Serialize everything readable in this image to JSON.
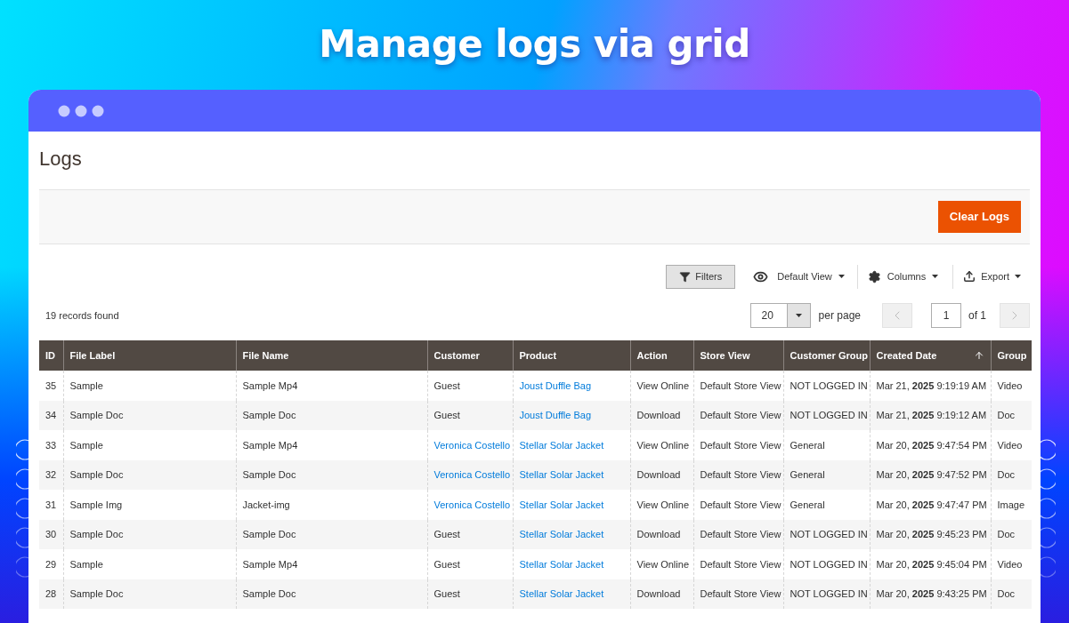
{
  "banner": {
    "title": "Manage logs via grid"
  },
  "page": {
    "title": "Logs",
    "action_button": "Clear Logs"
  },
  "toolbar": {
    "filters": {
      "label": "Filters",
      "selected": true
    },
    "view": "Default View",
    "columns": "Columns",
    "export": "Export"
  },
  "records": "19 records found",
  "pagination": {
    "per_page_value": "20",
    "per_page_label": "per page",
    "page": "1",
    "of": "of 1"
  },
  "table": {
    "columns": [
      {
        "label": "ID"
      },
      {
        "label": "File Label"
      },
      {
        "label": "File Name"
      },
      {
        "label": "Customer"
      },
      {
        "label": "Product"
      },
      {
        "label": "Action"
      },
      {
        "label": "Store View"
      },
      {
        "label": "Customer Group"
      },
      {
        "label": "Created Date",
        "sorted": true
      },
      {
        "label": "Group"
      }
    ],
    "rows": [
      {
        "cells": [
          {
            "text": "35"
          },
          {
            "text": "Sample"
          },
          {
            "text": "Sample Mp4"
          },
          {
            "text": "Guest"
          },
          {
            "text": "Joust Duffle Bag",
            "kind": "link"
          },
          {
            "text": "View Online"
          },
          {
            "text": "Default Store View"
          },
          {
            "text": "NOT LOGGED IN"
          },
          {
            "text": "Mar 21, **2025** 9:19:19 AM"
          },
          {
            "text": "Video"
          }
        ]
      },
      {
        "cells": [
          {
            "text": "34"
          },
          {
            "text": "Sample Doc"
          },
          {
            "text": "Sample Doc"
          },
          {
            "text": "Guest"
          },
          {
            "text": "Joust Duffle Bag",
            "kind": "link"
          },
          {
            "text": "Download"
          },
          {
            "text": "Default Store View"
          },
          {
            "text": "NOT LOGGED IN"
          },
          {
            "text": "Mar 21, **2025** 9:19:12 AM"
          },
          {
            "text": "Doc"
          }
        ]
      },
      {
        "cells": [
          {
            "text": "33"
          },
          {
            "text": "Sample"
          },
          {
            "text": "Sample Mp4"
          },
          {
            "text": "Veronica Costello",
            "kind": "link"
          },
          {
            "text": "Stellar Solar Jacket",
            "kind": "link"
          },
          {
            "text": "View Online"
          },
          {
            "text": "Default Store View"
          },
          {
            "text": "General"
          },
          {
            "text": "Mar 20, **2025** 9:47:54 PM"
          },
          {
            "text": "Video"
          }
        ]
      },
      {
        "cells": [
          {
            "text": "32"
          },
          {
            "text": "Sample Doc"
          },
          {
            "text": "Sample Doc"
          },
          {
            "text": "Veronica Costello",
            "kind": "link"
          },
          {
            "text": "Stellar Solar Jacket",
            "kind": "link"
          },
          {
            "text": "Download"
          },
          {
            "text": "Default Store View"
          },
          {
            "text": "General"
          },
          {
            "text": "Mar 20, **2025** 9:47:52 PM"
          },
          {
            "text": "Doc"
          }
        ]
      },
      {
        "cells": [
          {
            "text": "31"
          },
          {
            "text": "Sample Img"
          },
          {
            "text": "Jacket-img"
          },
          {
            "text": "Veronica Costello",
            "kind": "link"
          },
          {
            "text": "Stellar Solar Jacket",
            "kind": "link"
          },
          {
            "text": "View Online"
          },
          {
            "text": "Default Store View"
          },
          {
            "text": "General"
          },
          {
            "text": "Mar 20, **2025** 9:47:47 PM"
          },
          {
            "text": "Image"
          }
        ]
      },
      {
        "cells": [
          {
            "text": "30"
          },
          {
            "text": "Sample Doc"
          },
          {
            "text": "Sample Doc"
          },
          {
            "text": "Guest"
          },
          {
            "text": "Stellar Solar Jacket",
            "kind": "link"
          },
          {
            "text": "Download"
          },
          {
            "text": "Default Store View"
          },
          {
            "text": "NOT LOGGED IN"
          },
          {
            "text": "Mar 20, **2025** 9:45:23 PM"
          },
          {
            "text": "Doc"
          }
        ]
      },
      {
        "cells": [
          {
            "text": "29"
          },
          {
            "text": "Sample"
          },
          {
            "text": "Sample Mp4"
          },
          {
            "text": "Guest"
          },
          {
            "text": "Stellar Solar Jacket",
            "kind": "link"
          },
          {
            "text": "View Online"
          },
          {
            "text": "Default Store View"
          },
          {
            "text": "NOT LOGGED IN"
          },
          {
            "text": "Mar 20, **2025** 9:45:04 PM"
          },
          {
            "text": "Video"
          }
        ]
      },
      {
        "cells": [
          {
            "text": "28"
          },
          {
            "text": "Sample Doc"
          },
          {
            "text": "Sample Doc"
          },
          {
            "text": "Guest"
          },
          {
            "text": "Stellar Solar Jacket",
            "kind": "link"
          },
          {
            "text": "Download"
          },
          {
            "text": "Default Store View"
          },
          {
            "text": "NOT LOGGED IN"
          },
          {
            "text": "Mar 20, **2025** 9:43:25 PM"
          },
          {
            "text": "Doc"
          }
        ]
      }
    ]
  }
}
